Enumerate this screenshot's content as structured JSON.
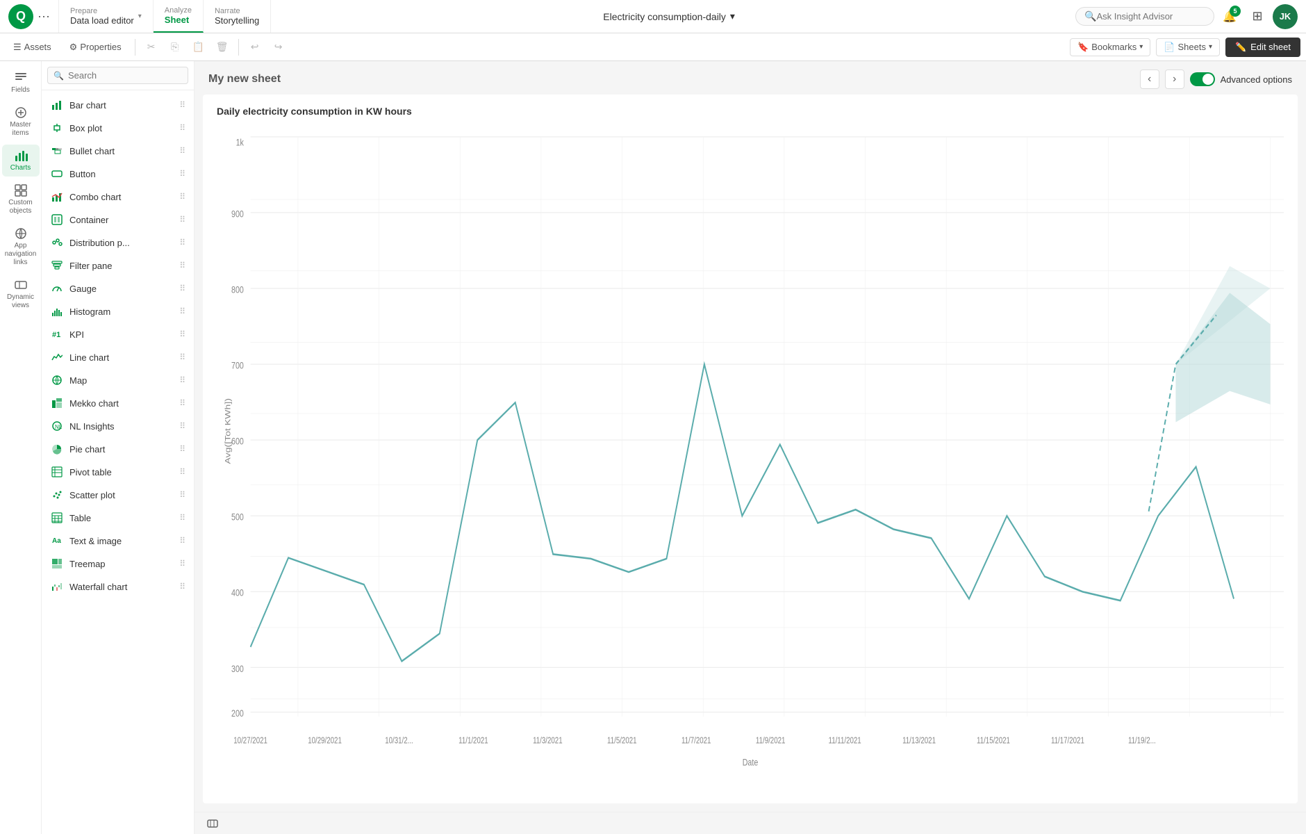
{
  "app": {
    "title": "Electricity consumption-daily",
    "logo_text": "Q"
  },
  "nav": {
    "dots_label": "•••",
    "tabs": [
      {
        "id": "prepare",
        "label": "Prepare",
        "subtitle": "Data load editor",
        "has_arrow": true,
        "active": false
      },
      {
        "id": "analyze",
        "label": "Analyze",
        "subtitle": "Sheet",
        "active": true
      },
      {
        "id": "narrate",
        "label": "Narrate",
        "subtitle": "Storytelling",
        "active": false
      }
    ],
    "search_placeholder": "Ask Insight Advisor",
    "notification_count": "5",
    "user_initials": "JK"
  },
  "toolbar": {
    "assets_label": "Assets",
    "properties_label": "Properties",
    "undo_label": "↩",
    "redo_label": "↪",
    "bookmarks_label": "Bookmarks",
    "sheets_label": "Sheets",
    "edit_sheet_label": "Edit sheet"
  },
  "sidebar": {
    "items": [
      {
        "id": "fields",
        "label": "Fields",
        "icon": "fields"
      },
      {
        "id": "master-items",
        "label": "Master items",
        "icon": "master"
      },
      {
        "id": "charts",
        "label": "Charts",
        "icon": "charts",
        "active": true
      },
      {
        "id": "custom-objects",
        "label": "Custom objects",
        "icon": "custom"
      },
      {
        "id": "app-nav",
        "label": "App navigation links",
        "icon": "nav"
      },
      {
        "id": "dynamic-views",
        "label": "Dynamic views",
        "icon": "dynamic"
      }
    ]
  },
  "charts_panel": {
    "search_placeholder": "Search",
    "items": [
      {
        "id": "bar-chart",
        "label": "Bar chart",
        "icon": "bar"
      },
      {
        "id": "box-plot",
        "label": "Box plot",
        "icon": "box"
      },
      {
        "id": "bullet-chart",
        "label": "Bullet chart",
        "icon": "bullet"
      },
      {
        "id": "button",
        "label": "Button",
        "icon": "button"
      },
      {
        "id": "combo-chart",
        "label": "Combo chart",
        "icon": "combo"
      },
      {
        "id": "container",
        "label": "Container",
        "icon": "container"
      },
      {
        "id": "distribution-p",
        "label": "Distribution p...",
        "icon": "distribution"
      },
      {
        "id": "filter-pane",
        "label": "Filter pane",
        "icon": "filter"
      },
      {
        "id": "gauge",
        "label": "Gauge",
        "icon": "gauge"
      },
      {
        "id": "histogram",
        "label": "Histogram",
        "icon": "histogram"
      },
      {
        "id": "kpi",
        "label": "KPI",
        "icon": "kpi"
      },
      {
        "id": "line-chart",
        "label": "Line chart",
        "icon": "line"
      },
      {
        "id": "map",
        "label": "Map",
        "icon": "map"
      },
      {
        "id": "mekko-chart",
        "label": "Mekko chart",
        "icon": "mekko"
      },
      {
        "id": "nl-insights",
        "label": "NL Insights",
        "icon": "nl"
      },
      {
        "id": "pie-chart",
        "label": "Pie chart",
        "icon": "pie"
      },
      {
        "id": "pivot-table",
        "label": "Pivot table",
        "icon": "pivot"
      },
      {
        "id": "scatter-plot",
        "label": "Scatter plot",
        "icon": "scatter"
      },
      {
        "id": "table",
        "label": "Table",
        "icon": "table"
      },
      {
        "id": "text-image",
        "label": "Text & image",
        "icon": "text"
      },
      {
        "id": "treemap",
        "label": "Treemap",
        "icon": "treemap"
      },
      {
        "id": "waterfall-chart",
        "label": "Waterfall chart",
        "icon": "waterfall"
      }
    ]
  },
  "sheet": {
    "title": "My new sheet",
    "chart_title": "Daily electricity consumption in KW hours",
    "advanced_options_label": "Advanced options",
    "y_axis_label": "Avg([Tot KWh])",
    "x_axis_label": "Date",
    "nav_prev": "‹",
    "nav_next": "›"
  },
  "chart_data": {
    "y_ticks": [
      "1k",
      "900",
      "800",
      "700",
      "600",
      "500",
      "400",
      "300",
      "200"
    ],
    "x_labels": [
      "10/27/2021",
      "10/29/2021",
      "10/31/2...",
      "11/1/2021",
      "11/3/2021",
      "11/5/2021",
      "11/7/2021",
      "11/9/2021",
      "11/11/2021",
      "11/13/2021",
      "11/15/2021",
      "11/17/2021",
      "11/19/2..."
    ],
    "line_points": [
      [
        0,
        290
      ],
      [
        1,
        410
      ],
      [
        2,
        390
      ],
      [
        3,
        370
      ],
      [
        4,
        265
      ],
      [
        5,
        300
      ],
      [
        6,
        560
      ],
      [
        7,
        630
      ],
      [
        8,
        400
      ],
      [
        9,
        360
      ],
      [
        10,
        390
      ],
      [
        11,
        410
      ],
      [
        12,
        700
      ],
      [
        13,
        500
      ],
      [
        14,
        600
      ],
      [
        15,
        480
      ],
      [
        16,
        510
      ],
      [
        17,
        475
      ],
      [
        18,
        460
      ],
      [
        19,
        350
      ],
      [
        20,
        480
      ],
      [
        21,
        375
      ],
      [
        22,
        360
      ],
      [
        23,
        350
      ],
      [
        24,
        480
      ],
      [
        25,
        550
      ],
      [
        26,
        360
      ]
    ]
  }
}
